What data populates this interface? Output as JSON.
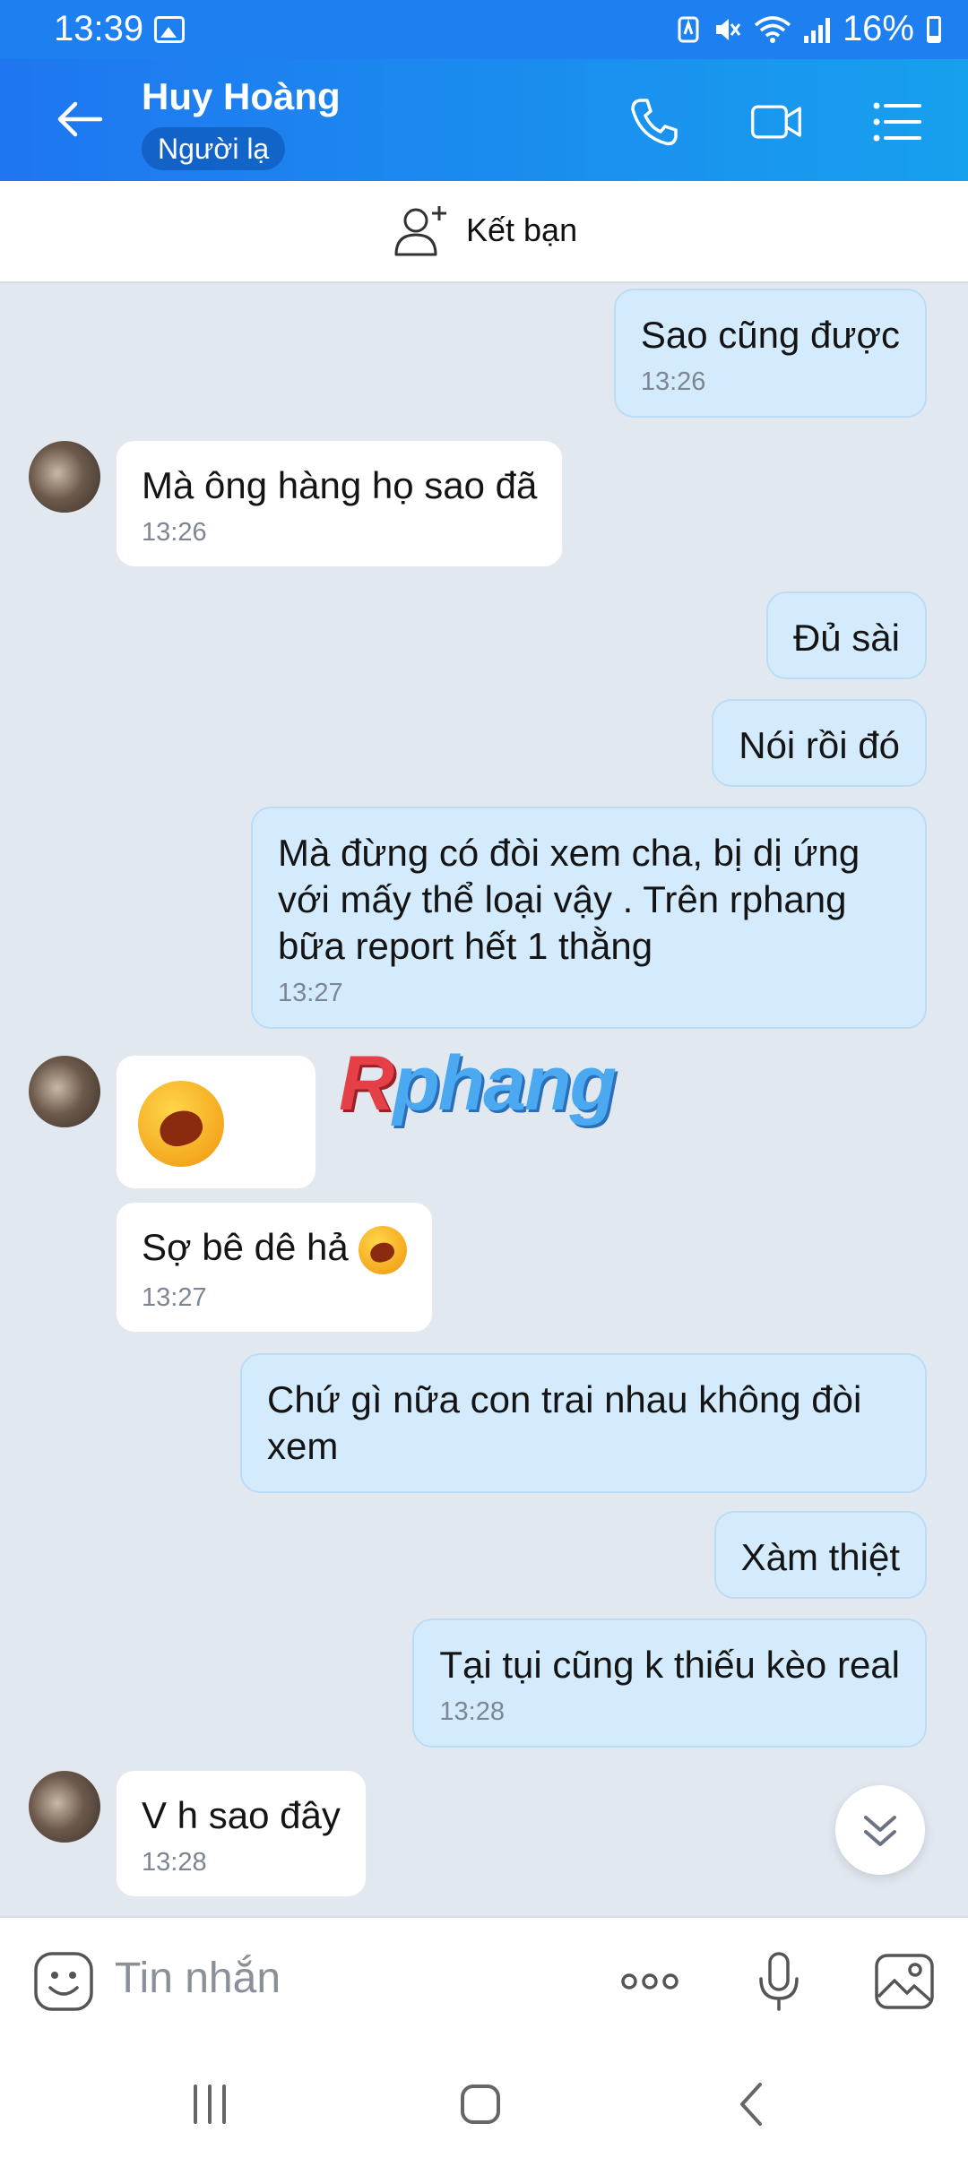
{
  "status_bar": {
    "time": "13:39",
    "battery": "16%"
  },
  "header": {
    "contact_name": "Huy Hoàng",
    "badge": "Người lạ",
    "icons": [
      "back-arrow-icon",
      "phone-icon",
      "video-call-icon",
      "menu-list-icon"
    ]
  },
  "friend_bar": {
    "label": "Kết bạn"
  },
  "messages": [
    {
      "side": "out",
      "text": "Sao cũng được",
      "time": "13:26"
    },
    {
      "side": "in",
      "text": "Mà ông hàng họ sao đã",
      "time": "13:26"
    },
    {
      "side": "out",
      "text": "Đủ sài"
    },
    {
      "side": "out",
      "text": "Nói rồi đó"
    },
    {
      "side": "out",
      "text": "Mà đừng có đòi xem cha, bị dị ứng với mấy thể loại vậy . Trên rphang bữa report hết 1 thằng",
      "time": "13:27"
    },
    {
      "side": "in",
      "emoji": "laughing-crying-emoji"
    },
    {
      "side": "in",
      "text": "Sợ bê dê hả",
      "time": "13:27"
    },
    {
      "side": "out",
      "text": "Chứ gì nữa con trai nhau không đòi xem"
    },
    {
      "side": "out",
      "text": "Xàm thiệt"
    },
    {
      "side": "out",
      "text": "Tại tụi cũng k thiếu kèo real",
      "time": "13:28"
    },
    {
      "side": "in",
      "text": "V h sao đây",
      "time": "13:28"
    }
  ],
  "watermark": {
    "first": "R",
    "rest": "phang"
  },
  "input": {
    "placeholder": "Tin nhắn"
  },
  "colors": {
    "header_start": "#1f76f0",
    "header_end": "#17a0ee",
    "outgoing_bubble": "#d3ebfd",
    "incoming_bubble": "#ffffff",
    "chat_bg": "#e2e8f0"
  }
}
